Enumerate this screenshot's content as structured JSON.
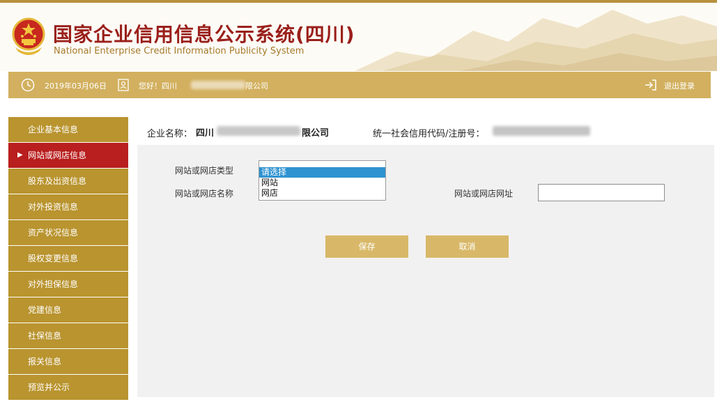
{
  "header": {
    "title_cn": "国家企业信用信息公示系统(四川)",
    "title_en": "National Enterprise Credit Information Publicity System"
  },
  "infobar": {
    "date": "2019年03月06日",
    "greeting": "您好！四川",
    "company_suffix": "限公司",
    "logout_label": "退出登录"
  },
  "sidebar": {
    "items": [
      {
        "label": "企业基本信息"
      },
      {
        "label": "网站或网店信息",
        "active": true
      },
      {
        "label": "股东及出资信息"
      },
      {
        "label": "对外投资信息"
      },
      {
        "label": "资产状况信息"
      },
      {
        "label": "股权变更信息"
      },
      {
        "label": "对外担保信息"
      },
      {
        "label": "党建信息"
      },
      {
        "label": "社保信息"
      },
      {
        "label": "报关信息"
      },
      {
        "label": "预览并公示"
      }
    ]
  },
  "main": {
    "company_label": "企业名称：",
    "company_name_start": "四川",
    "company_name_end": "限公司",
    "code_label": "统一社会信用代码/注册号："
  },
  "form": {
    "type_label": "网站或网店类型",
    "name_label": "网站或网店名称",
    "url_label": "网站或网店网址",
    "url_value": "",
    "type_options": [
      "请选择",
      "网站",
      "网店"
    ],
    "type_selected": "请选择",
    "save_label": "保存",
    "cancel_label": "取消"
  },
  "colors": {
    "gold_bar": "#d2b05f",
    "sidebar_gold": "#b9942f",
    "sidebar_active": "#b81f1e",
    "button_gold": "#d8b868",
    "title_red": "#9a1f1a",
    "select_highlight": "#2f93d1"
  },
  "icons": {
    "clock": "clock-icon",
    "user": "user-card-icon",
    "logout": "logout-icon",
    "emblem": "national-emblem-icon",
    "active_marker": "triangle-right-icon"
  }
}
